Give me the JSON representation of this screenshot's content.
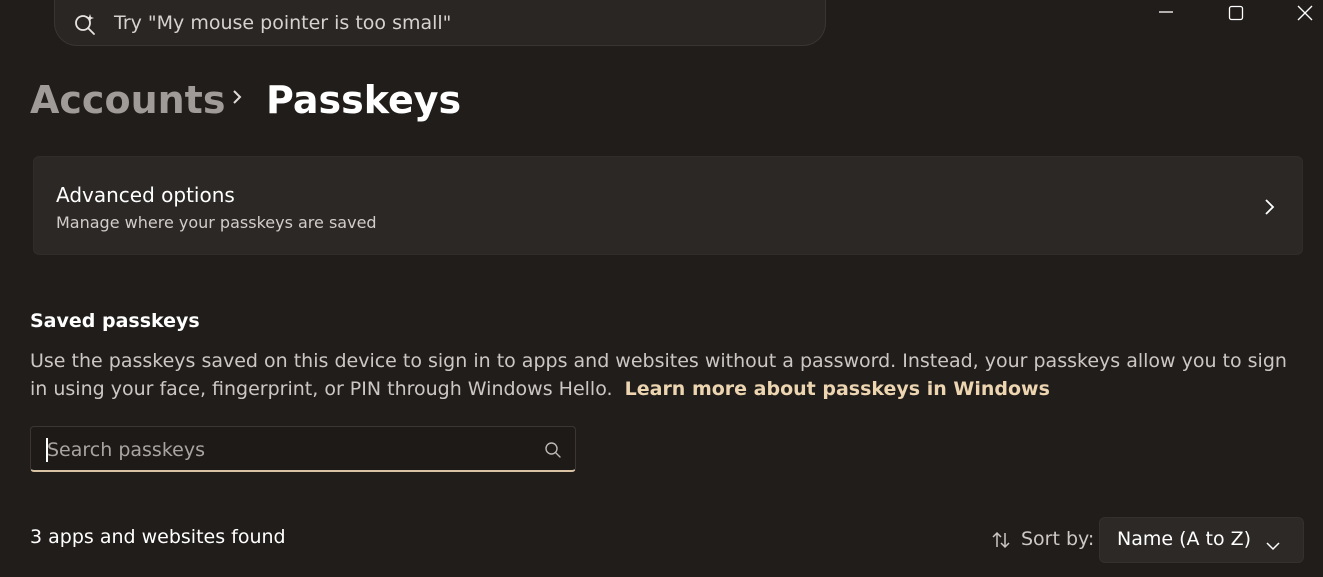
{
  "title_bar": {
    "search_placeholder": "Try \"My mouse pointer is too small\""
  },
  "breadcrumb": {
    "parent": "Accounts",
    "current": "Passkeys"
  },
  "advanced_options": {
    "title": "Advanced options",
    "subtitle": "Manage where your passkeys are saved"
  },
  "saved_passkeys": {
    "heading": "Saved passkeys",
    "description": "Use the passkeys saved on this device to sign in to apps and websites without a password. Instead, your passkeys allow you to sign in using your face, fingerprint, or PIN through Windows Hello.",
    "learn_more_link": "Learn more about passkeys in Windows",
    "search_placeholder": "Search passkeys",
    "search_value": "",
    "results_count": "3 apps and websites found",
    "sort_label": "Sort by:",
    "sort_value": "Name (A to Z)"
  },
  "icons": {
    "search": "search-sparkle-icon",
    "minimize": "minimize-icon",
    "maximize": "maximize-icon",
    "close": "close-icon",
    "breadcrumb_separator": "chevron-right-icon",
    "card_chevron": "chevron-right-icon",
    "field_search": "search-icon",
    "sort": "sort-icon",
    "dropdown": "chevron-down-icon"
  },
  "colors": {
    "background": "#211d1b",
    "card": "#2c2826",
    "accent": "#d9c3a4",
    "link": "#ecd5b0"
  }
}
